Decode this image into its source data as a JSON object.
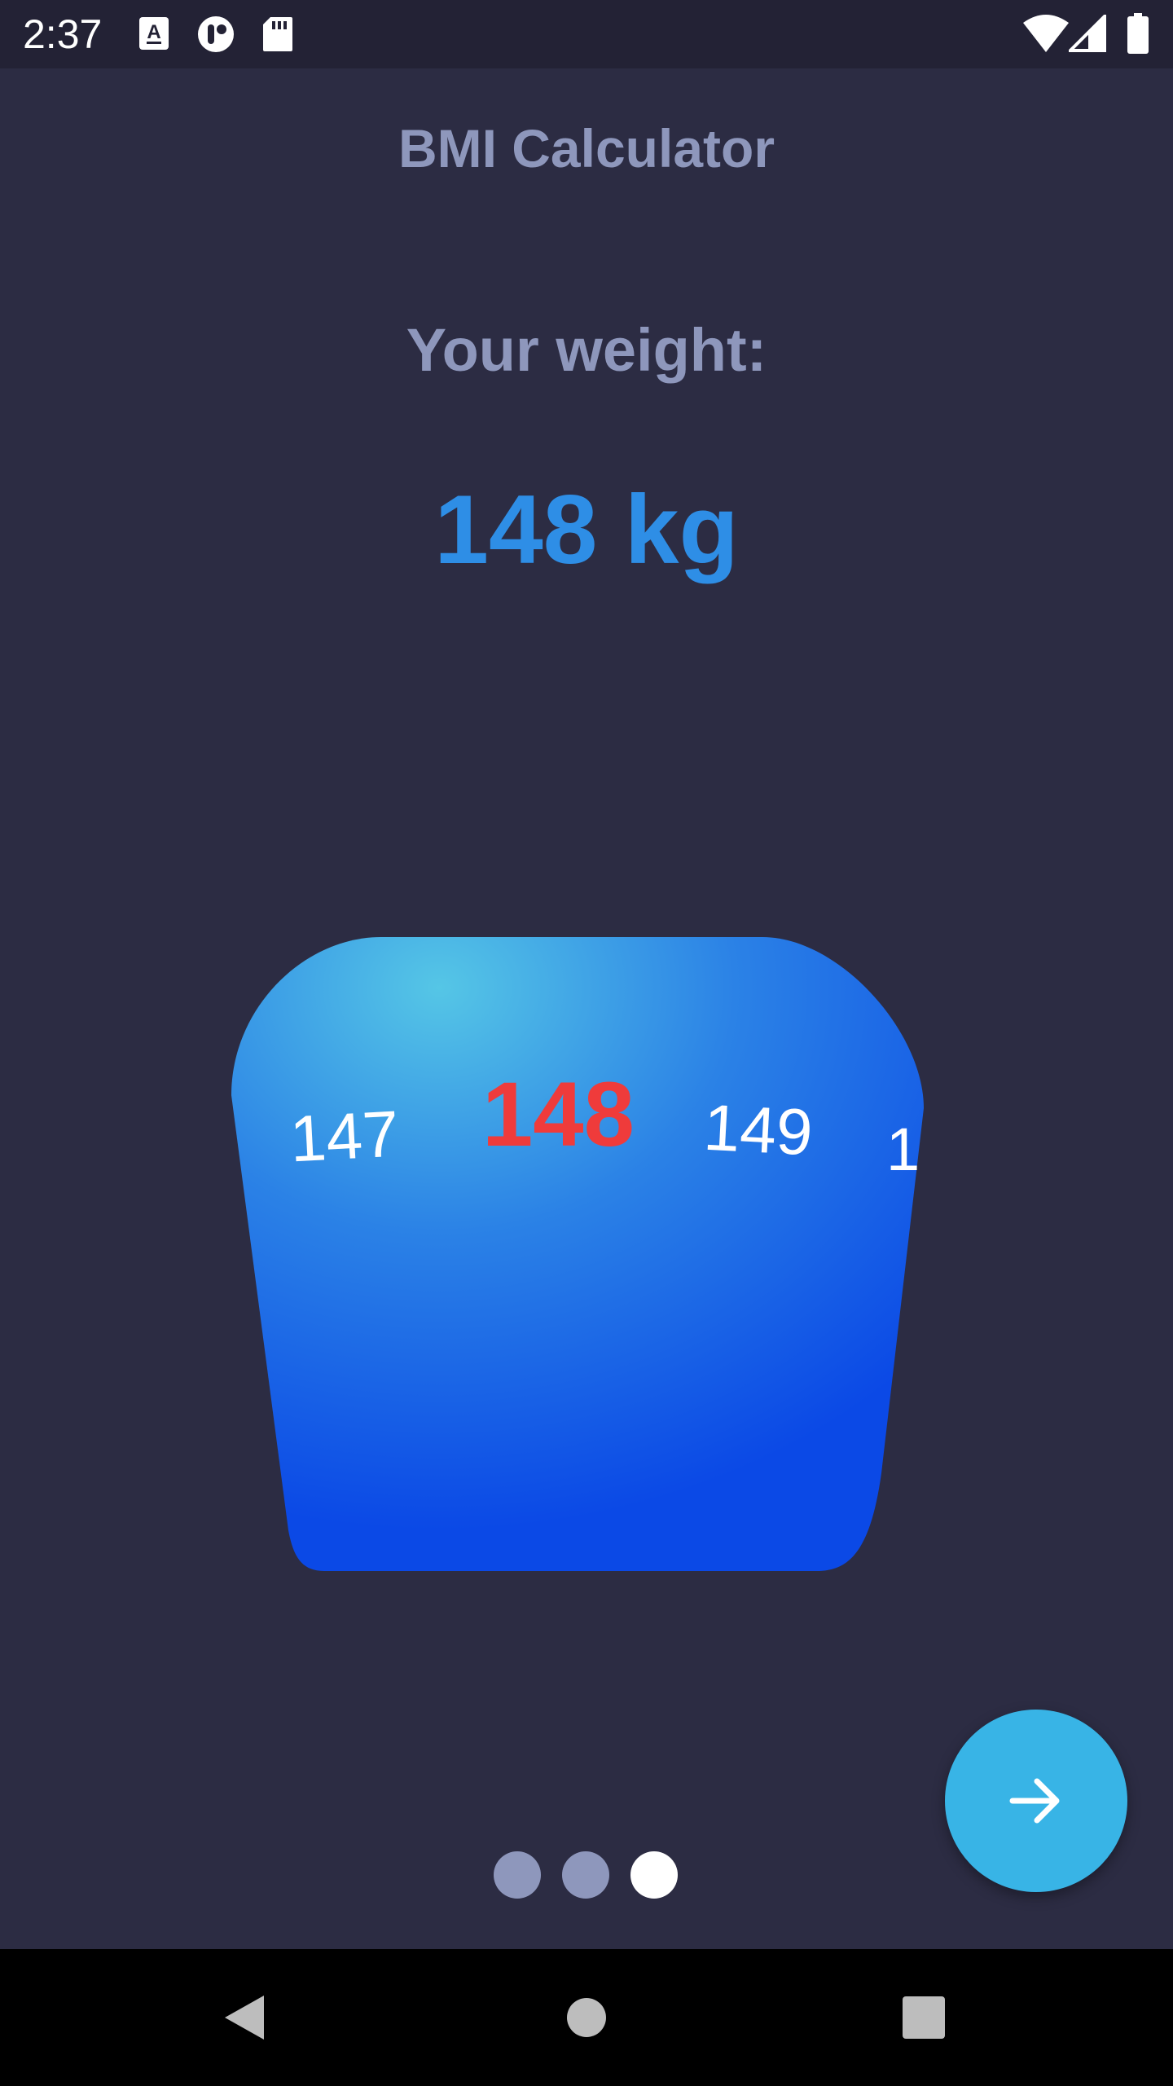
{
  "status_bar": {
    "time": "2:37",
    "icons": [
      "text-a-icon",
      "podcast-icon",
      "sd-card-icon",
      "wifi-icon",
      "cell-signal-icon",
      "battery-icon"
    ]
  },
  "app": {
    "title": "BMI Calculator",
    "prompt": "Your weight:",
    "weight_display": "148 kg"
  },
  "picker": {
    "values": [
      "147",
      "148",
      "149",
      "1"
    ],
    "selected_index": 1,
    "colors": {
      "selected": "#ef3b3b",
      "unselected": "#ffffff",
      "gradient_center": "#55c6e6",
      "gradient_edge": "#0b49e6"
    }
  },
  "pagination": {
    "count": 3,
    "active_index": 2
  },
  "fab": {
    "icon": "arrow-right-icon",
    "color": "#38b4e6"
  },
  "nav_bar": {
    "buttons": [
      "back-icon",
      "home-icon",
      "recents-icon"
    ]
  },
  "colors": {
    "background": "#2c2c43",
    "status_bar": "#232235",
    "muted_text": "#8e97bc",
    "accent_blue": "#2e8ee6"
  }
}
